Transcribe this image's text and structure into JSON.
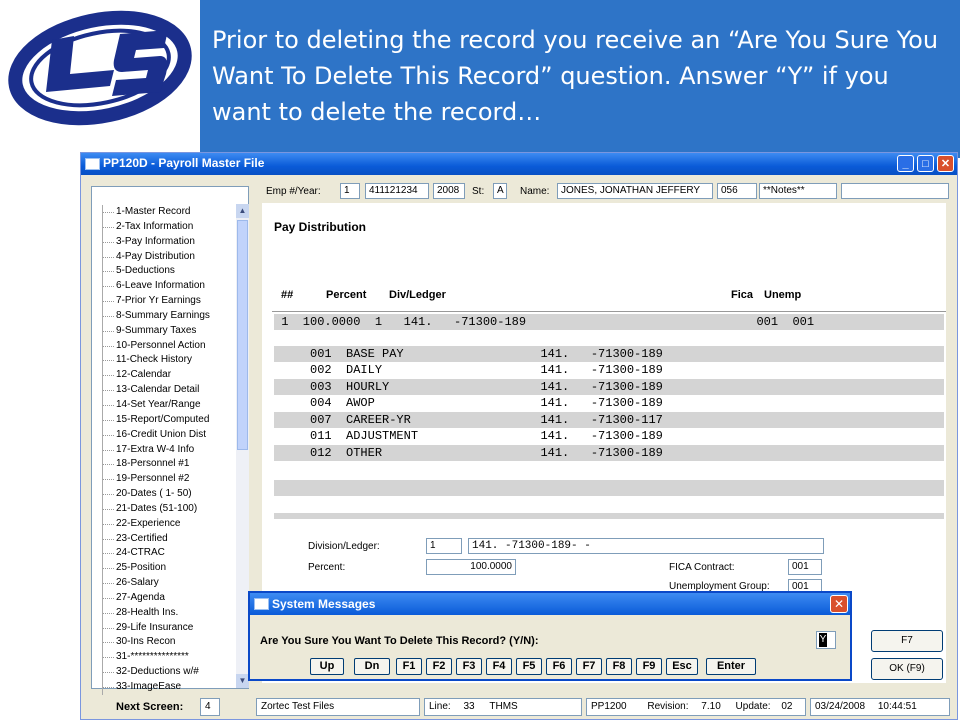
{
  "banner": {
    "text": "Prior to deleting the record you receive an “Are You Sure You Want To Delete This Record” question.  Answer “Y” if you want to delete the record…"
  },
  "window": {
    "title": "PP120D - Payroll Master File"
  },
  "header": {
    "emp_label": "Emp #/Year:",
    "emp_seq": "1",
    "emp_id": "411121234",
    "year": "2008",
    "st_label": "St:",
    "st_value": "A",
    "name_label": "Name:",
    "name_value": "JONES, JONATHAN JEFFERY",
    "code": "056",
    "notes": "**Notes**",
    "extra": ""
  },
  "nav": {
    "items": [
      "1-Master Record",
      "2-Tax Information",
      "3-Pay Information",
      "4-Pay Distribution",
      "5-Deductions",
      "6-Leave Information",
      "7-Prior Yr Earnings",
      "8-Summary Earnings",
      "9-Summary Taxes",
      "10-Personnel Action",
      "11-Check History",
      "12-Calendar",
      "13-Calendar Detail",
      "14-Set Year/Range",
      "15-Report/Computed",
      "16-Credit Union Dist",
      "17-Extra W-4 Info",
      "18-Personnel #1",
      "19-Personnel #2",
      "20-Dates ( 1- 50)",
      "21-Dates (51-100)",
      "22-Experience",
      "23-Certified",
      "24-CTRAC",
      "25-Position",
      "26-Salary",
      "27-Agenda",
      "28-Health Ins.",
      "29-Life Insurance",
      "30-Ins Recon",
      "31-***************",
      "32-Deductions w/#",
      "33-ImageEase"
    ]
  },
  "section": {
    "title": "Pay Distribution",
    "columns": {
      "num": "##",
      "percent": "Percent",
      "div": "Div/Ledger",
      "fica": "Fica",
      "unemp": "Unemp"
    }
  },
  "table": {
    "main_row": " 1  100.0000  1   141.   -71300-189                                001  001",
    "rows": [
      "     001  BASE PAY                   141.   -71300-189",
      "     002  DAILY                      141.   -71300-189",
      "     003  HOURLY                     141.   -71300-189",
      "     004  AWOP                       141.   -71300-189",
      "     007  CAREER-YR                  141.   -71300-117",
      "     011  ADJUSTMENT                 141.   -71300-189",
      "     012  OTHER                      141.   -71300-189"
    ]
  },
  "detail": {
    "division_label": "Division/Ledger:",
    "division_num": "1",
    "division_ledger": "141.   -71300-189-     -",
    "percent_label": "Percent:",
    "percent_value": "100.0000",
    "fica_label": "FICA Contract:",
    "fica_value": "001",
    "unemp_label": "Unemployment Group:",
    "unemp_value": "001"
  },
  "dialog": {
    "title": "System Messages",
    "question": "Are You Sure You Want To Delete This Record? (Y/N):",
    "answer": "Y",
    "buttons": [
      "Up",
      "Dn",
      "F1",
      "F2",
      "F3",
      "F4",
      "F5",
      "F6",
      "F7",
      "F8",
      "F9",
      "Esc",
      "Enter"
    ]
  },
  "right_buttons": {
    "f7": "F7",
    "ok": "OK (F9)"
  },
  "status": {
    "next_label": "Next Screen:",
    "next_value": "4",
    "db": "Zortec Test Files",
    "line_label": "Line:",
    "line_value": "33",
    "user": "THMS",
    "program": "PP1200",
    "revision_label": "Revision:",
    "revision_value": "7.10",
    "update_label": "Update:",
    "update_value": "02",
    "date": "03/24/2008",
    "time": "10:44:51"
  }
}
